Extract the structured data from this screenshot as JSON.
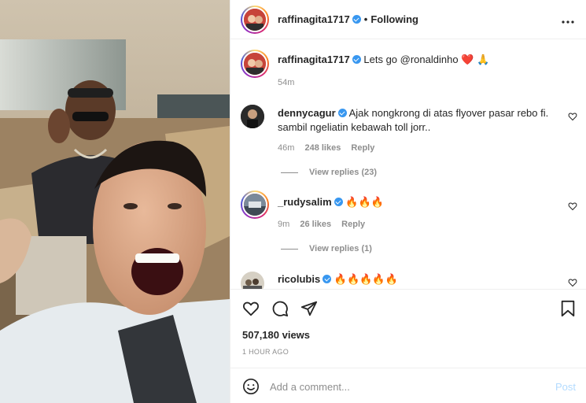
{
  "media": {
    "kind": "photo",
    "description_icon": "car-selfie-photo"
  },
  "post": {
    "author": "raffinagita1717",
    "separator": "•",
    "follow_status": "Following",
    "more_icon": "more-options-icon"
  },
  "caption": {
    "user": "raffinagita1717",
    "text": "Lets go @ronaldinho ❤️ 🙏",
    "time": "54m"
  },
  "comments": [
    {
      "user": "dennycagur",
      "text": "Ajak nongkrong di atas flyover pasar rebo fi. sambil ngeliatin kebawah toll jorr..",
      "time": "46m",
      "likes": "248 likes",
      "reply": "Reply",
      "view_replies": "View replies (23)"
    },
    {
      "user": "_rudysalim",
      "text": "🔥🔥🔥",
      "time": "9m",
      "likes": "26 likes",
      "reply": "Reply",
      "view_replies": "View replies (1)"
    },
    {
      "user": "ricolubis",
      "text": "🔥🔥🔥🔥🔥"
    }
  ],
  "actions": {
    "like_icon": "heart-icon",
    "comment_icon": "comment-icon",
    "share_icon": "share-icon",
    "save_icon": "bookmark-icon"
  },
  "stats": {
    "views": "507,180 views",
    "posted": "1 HOUR AGO"
  },
  "composer": {
    "placeholder": "Add a comment...",
    "post_label": "Post"
  },
  "colors": {
    "verified": "#3897f0",
    "muted": "#8e8e8e",
    "post_disabled": "#b3dbff"
  }
}
